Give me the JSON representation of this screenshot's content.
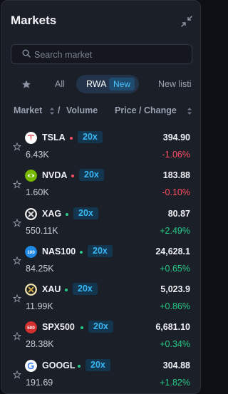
{
  "header": {
    "title": "Markets"
  },
  "search": {
    "placeholder": "Search market"
  },
  "tabs": {
    "all": "All",
    "rwa": "RWA",
    "rwa_badge": "New",
    "new_listing": "New listi"
  },
  "columns": {
    "market": "Market",
    "separator": "/",
    "volume": "Volume",
    "price": "Price / Change"
  },
  "colors": {
    "negative": "#ff4d62",
    "positive": "#27c987",
    "accent": "#38b7f5"
  },
  "markets": [
    {
      "symbol": "TSLA",
      "leverage": "20x",
      "volume": "6.43K",
      "price": "394.90",
      "change": "-1.06%",
      "direction": "down",
      "icon": "tesla-logo-icon"
    },
    {
      "symbol": "NVDA",
      "leverage": "20x",
      "volume": "1.60K",
      "price": "183.88",
      "change": "-0.10%",
      "direction": "down",
      "icon": "nvidia-logo-icon"
    },
    {
      "symbol": "XAG",
      "leverage": "20x",
      "volume": "550.11K",
      "price": "80.87",
      "change": "+2.49%",
      "direction": "up",
      "icon": "silver-logo-icon"
    },
    {
      "symbol": "NAS100",
      "leverage": "20x",
      "volume": "84.25K",
      "price": "24,628.1",
      "change": "+0.65%",
      "direction": "up",
      "icon": "nasdaq-100-logo-icon"
    },
    {
      "symbol": "XAU",
      "leverage": "20x",
      "volume": "11.99K",
      "price": "5,023.9",
      "change": "+0.86%",
      "direction": "up",
      "icon": "gold-logo-icon"
    },
    {
      "symbol": "SPX500",
      "leverage": "20x",
      "volume": "28.38K",
      "price": "6,681.10",
      "change": "+0.34%",
      "direction": "up",
      "icon": "sp-500-logo-icon"
    },
    {
      "symbol": "GOOGL",
      "leverage": "20x",
      "volume": "191.69",
      "price": "304.88",
      "change": "+1.82%",
      "direction": "up",
      "icon": "google-logo-icon"
    }
  ]
}
